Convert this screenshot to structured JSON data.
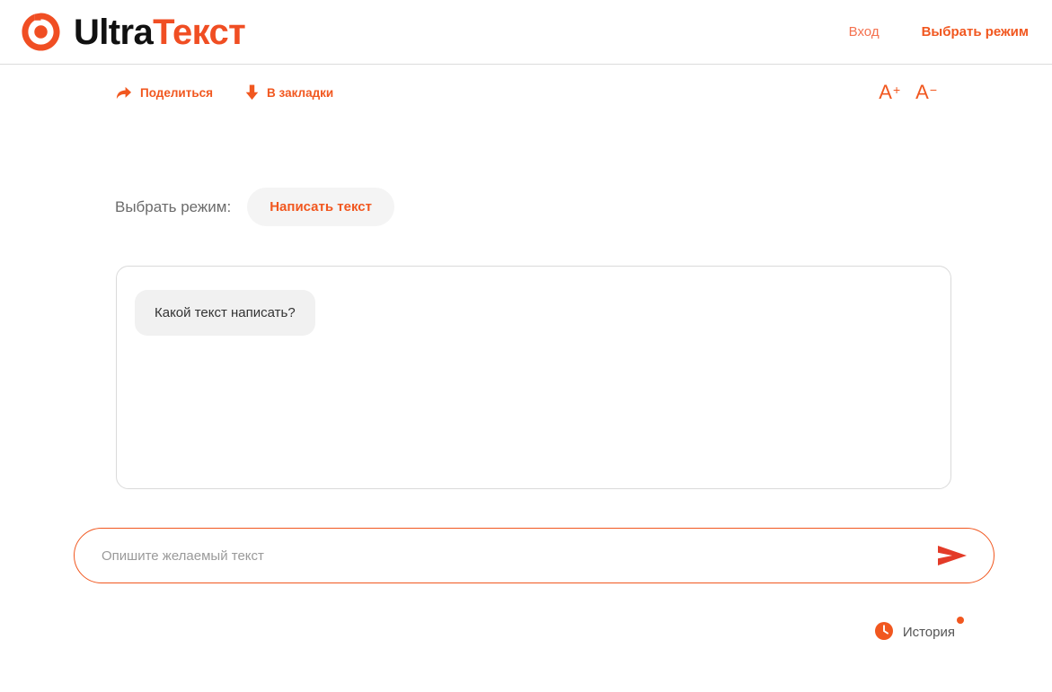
{
  "brand": {
    "word_black": "Ultra",
    "word_orange": "Текст",
    "logo_icon": "target-ring-icon"
  },
  "header": {
    "nav": {
      "login": "Вход",
      "select_mode": "Выбрать режим"
    }
  },
  "toolbar": {
    "share": {
      "label": "Поделиться",
      "icon": "share-arrow-icon"
    },
    "bookmark": {
      "label": "В закладки",
      "icon": "download-arrow-icon"
    },
    "font_increase": {
      "letter": "A",
      "sign": "+"
    },
    "font_decrease": {
      "letter": "A",
      "sign": "−"
    }
  },
  "main": {
    "mode_label": "Выбрать режим:",
    "mode_value": "Написать текст",
    "messages": [
      {
        "role": "assistant",
        "text": "Какой текст написать?"
      }
    ],
    "prompt": {
      "value": "",
      "placeholder": "Опишите желаемый текст",
      "send_icon": "send-arrow-icon"
    },
    "history": {
      "label": "История",
      "icon": "clock-icon",
      "has_badge": true
    }
  },
  "colors": {
    "accent": "#f1571f",
    "accent_light": "#f4714f",
    "send": "#e33b28",
    "text_dark": "#111111",
    "text_gray": "#6b6b6b",
    "border": "#dadada",
    "bubble_bg": "#f1f1f1",
    "pill_bg": "#f4f4f4"
  }
}
